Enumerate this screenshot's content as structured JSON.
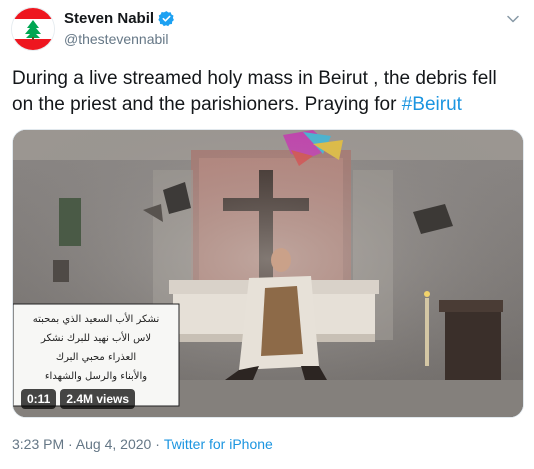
{
  "tweet": {
    "author": {
      "display_name": "Steven Nabil",
      "handle": "@thestevennabil",
      "verified": true,
      "avatar": "lebanon-flag"
    },
    "text_prefix": "During a live streamed holy mass in Beirut , the debris fell on the priest and the parishioners. Praying for ",
    "hashtag": "#Beirut",
    "media": {
      "duration": "0:11",
      "views": "2.4M views",
      "overlay_lines": [
        "نشكر الأب السعيد الذي بمحبته",
        "لاس الأب نهيد للبرك نشكر",
        "العذراء محبي البرك",
        "والأبناء والرسل والشهداء"
      ]
    },
    "timestamp": "3:23 PM · Aug 4, 2020 · ",
    "source": "Twitter for iPhone"
  },
  "colors": {
    "link": "#1b95e0",
    "verified": "#1da1f2",
    "secondary_text": "#657786",
    "primary_text": "#14171a"
  }
}
